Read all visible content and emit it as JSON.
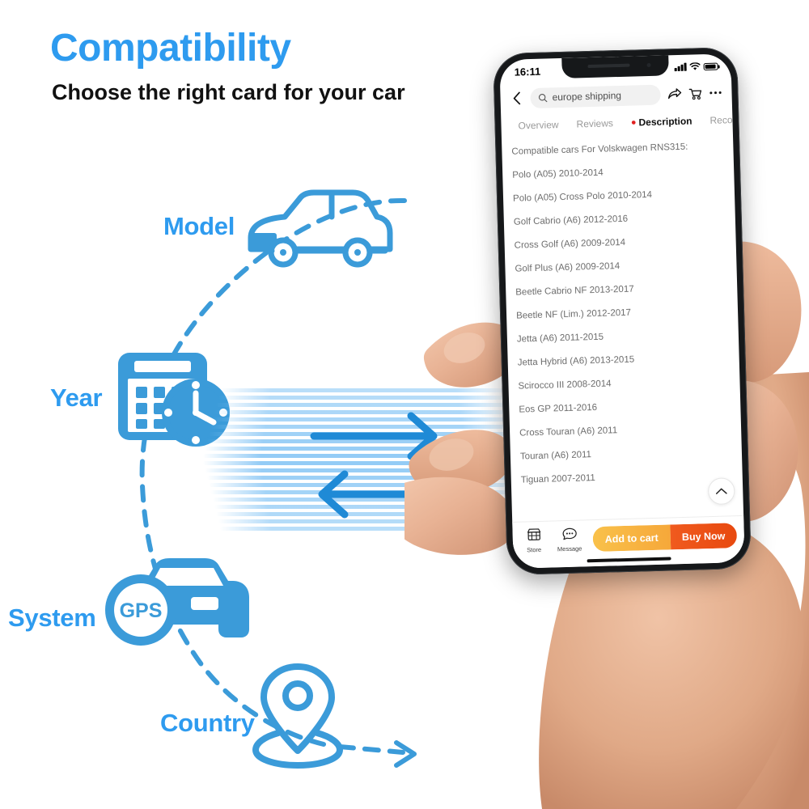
{
  "header": {
    "title": "Compatibility",
    "subtitle": "Choose the right card for your car",
    "title_color": "#2e9bef"
  },
  "diagram": {
    "accent_color": "#3b9bd9",
    "nodes": [
      {
        "label": "Model",
        "icon": "car-side-icon"
      },
      {
        "label": "Year",
        "icon": "calendar-clock-icon"
      },
      {
        "label": "System",
        "icon": "gps-car-icon",
        "badge": "GPS"
      },
      {
        "label": "Country",
        "icon": "map-pin-icon"
      }
    ],
    "arrows": [
      {
        "name": "arrow-right",
        "direction": "right"
      },
      {
        "name": "arrow-left",
        "direction": "left"
      }
    ]
  },
  "phone": {
    "status_bar": {
      "time": "16:11",
      "icons": [
        "signal-icon",
        "wifi-icon",
        "battery-icon"
      ]
    },
    "nav": {
      "back_icon": "chevron-left-icon",
      "search_icon": "search-icon",
      "search_value": "europe shipping",
      "search_placeholder": "Search",
      "share_icon": "share-icon",
      "cart_icon": "cart-icon",
      "more_icon": "more-dots-icon"
    },
    "tabs": [
      {
        "label": "Overview",
        "active": false
      },
      {
        "label": "Reviews",
        "active": false
      },
      {
        "label": "Description",
        "active": true,
        "pin_icon": "location-pin-icon",
        "pin_color": "#e02020"
      },
      {
        "label": "Recom",
        "active": false
      }
    ],
    "content": {
      "heading": "Compatible cars For Volskwagen RNS315:",
      "items": [
        "Polo (A05) 2010-2014",
        "Polo (A05) Cross Polo 2010-2014",
        "Golf Cabrio (A6) 2012-2016",
        "Cross Golf (A6) 2009-2014",
        "Golf Plus (A6) 2009-2014",
        "Beetle Cabrio NF 2013-2017",
        "Beetle NF (Lim.) 2012-2017",
        "Jetta (A6) 2011-2015",
        "Jetta Hybrid (A6) 2013-2015",
        "Scirocco III 2008-2014",
        "Eos GP 2011-2016",
        "Cross Touran (A6) 2011",
        "Touran (A6) 2011",
        "Tiguan 2007-2011"
      ]
    },
    "scroll_top_icon": "chevron-up-icon",
    "action_bar": {
      "store_label": "Store",
      "store_icon": "store-icon",
      "message_label": "Message",
      "message_icon": "chat-bubble-icon",
      "add_to_cart_label": "Add to cart",
      "add_to_cart_color": "#f6a83a",
      "buy_now_label": "Buy Now",
      "buy_now_color": "#e8490f"
    }
  }
}
